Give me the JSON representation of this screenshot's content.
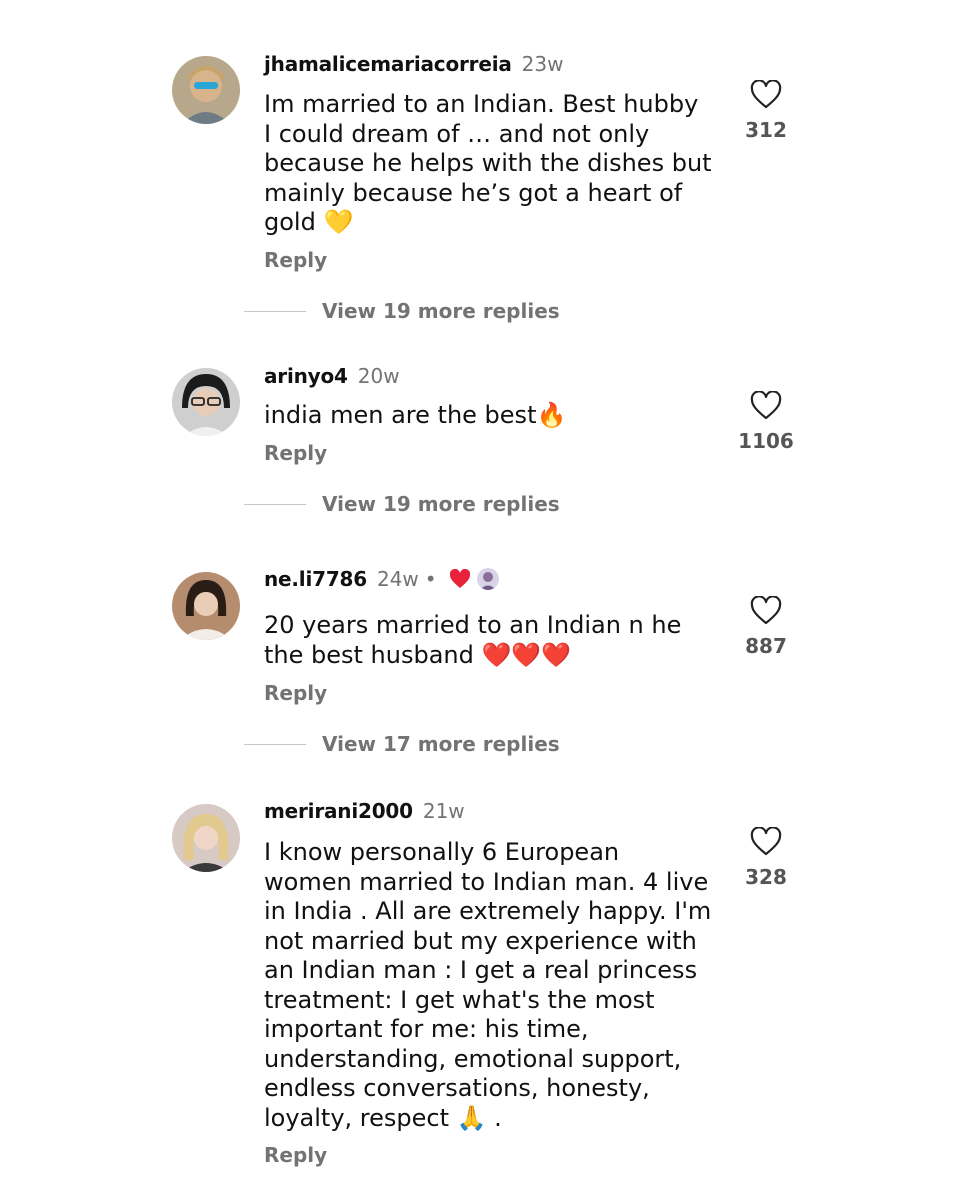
{
  "colors": {
    "text": "#111111",
    "muted": "#737373",
    "accent_red": "#e8223a",
    "heart_yellow": "#f5c518"
  },
  "comments": [
    {
      "username": "jhamalicemariacorreia",
      "time": "23w",
      "text": "Im married to an Indian. Best hubby I could dream of … and not only because he helps with the dishes but mainly because he’s got a heart of gold 💛",
      "reply_label": "Reply",
      "likes": "312",
      "view_replies": "View 19 more replies",
      "avatar_icon": "user-avatar-sunglasses"
    },
    {
      "username": "arinyo4",
      "time": "20w",
      "text": "india men are the best🔥",
      "reply_label": "Reply",
      "likes": "1106",
      "view_replies": "View 19 more replies",
      "avatar_icon": "user-avatar-glasses"
    },
    {
      "username": "ne.li7786",
      "time": "24w",
      "dot": "•",
      "text": "20 years married to an Indian n he the best husband ❤️❤️❤️",
      "reply_label": "Reply",
      "likes": "887",
      "view_replies": "View 17 more replies",
      "avatar_icon": "user-avatar-dark-hair",
      "creator_liked_badge": "heart-icon"
    },
    {
      "username": "merirani2000",
      "time": "21w",
      "text": "I know personally 6 European women married to Indian man. 4 live in India . All are extremely happy. I'm not married but my experience with an Indian man : I get a real princess treatment: I get what's the most important for me: his time, understanding, emotional support, endless conversations, honesty, loyalty, respect 🙏 .",
      "reply_label": "Reply",
      "likes": "328",
      "avatar_icon": "user-avatar-blonde"
    }
  ]
}
